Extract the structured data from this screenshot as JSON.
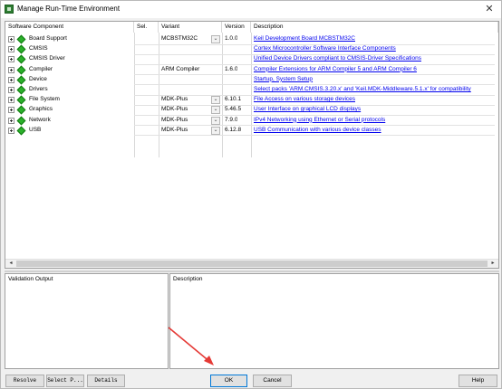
{
  "window": {
    "title": "Manage Run-Time Environment",
    "close_glyph": "✕"
  },
  "table": {
    "columns": [
      "Software Component",
      "Sel.",
      "Variant",
      "Version",
      "Description"
    ],
    "rows": [
      {
        "component": "Board Support",
        "sel": "",
        "variant": "MCBSTM32C",
        "has_dropdown": true,
        "version": "1.0.0",
        "description": "Keil Development Board MCBSTM32C",
        "desc_link": true
      },
      {
        "component": "CMSIS",
        "sel": "",
        "variant": "",
        "has_dropdown": false,
        "version": "",
        "description": "Cortex Microcontroller Software Interface Components",
        "desc_link": true
      },
      {
        "component": "CMSIS Driver",
        "sel": "",
        "variant": "",
        "has_dropdown": false,
        "version": "",
        "description": "Unified Device Drivers compliant to CMSIS-Driver Specifications",
        "desc_link": true
      },
      {
        "component": "Compiler",
        "sel": "",
        "variant": "ARM Compiler",
        "has_dropdown": false,
        "version": "1.6.0",
        "description": "Compiler Extensions for ARM Compiler 5 and ARM Compiler 6",
        "desc_link": true
      },
      {
        "component": "Device",
        "sel": "",
        "variant": "",
        "has_dropdown": false,
        "version": "",
        "description": "Startup, System Setup",
        "desc_link": true
      },
      {
        "component": "Drivers",
        "sel": "",
        "variant": "",
        "has_dropdown": false,
        "version": "",
        "description": "Select packs 'ARM.CMSIS.3.20.x' and 'Keil.MDK-Middleware.5.1.x' for compatibility",
        "desc_link": true
      },
      {
        "component": "File System",
        "sel": "",
        "variant": "MDK-Plus",
        "has_dropdown": true,
        "version": "6.10.1",
        "description": "File Access on various storage devices",
        "desc_link": true
      },
      {
        "component": "Graphics",
        "sel": "",
        "variant": "MDK-Plus",
        "has_dropdown": true,
        "version": "5.46.5",
        "description": "User Interface on graphical LCD displays",
        "desc_link": true
      },
      {
        "component": "Network",
        "sel": "",
        "variant": "MDK-Plus",
        "has_dropdown": true,
        "version": "7.9.0",
        "description": "IPv4 Networking using Ethernet or Serial protocols",
        "desc_link": true
      },
      {
        "component": "USB",
        "sel": "",
        "variant": "MDK-Plus",
        "has_dropdown": true,
        "version": "6.12.8",
        "description": "USB Communication with various device classes",
        "desc_link": true
      }
    ]
  },
  "scroll": {
    "left_glyph": "◂",
    "right_glyph": "▸"
  },
  "validation": {
    "label": "Validation Output"
  },
  "description_panel": {
    "label": "Description"
  },
  "buttons": {
    "resolve": "Resolve",
    "select_packs": "Select P...",
    "details": "Details",
    "ok": "OK",
    "cancel": "Cancel",
    "help": "Help"
  },
  "colors": {
    "link": "#0000ee",
    "component_icon": "#2bb02b",
    "annotation_arrow": "#e53935",
    "focus": "#0078d7"
  },
  "icons": {
    "component": "green-diamond-icon",
    "expand": "plus-box-icon",
    "dropdown": "chevron-down-icon"
  }
}
